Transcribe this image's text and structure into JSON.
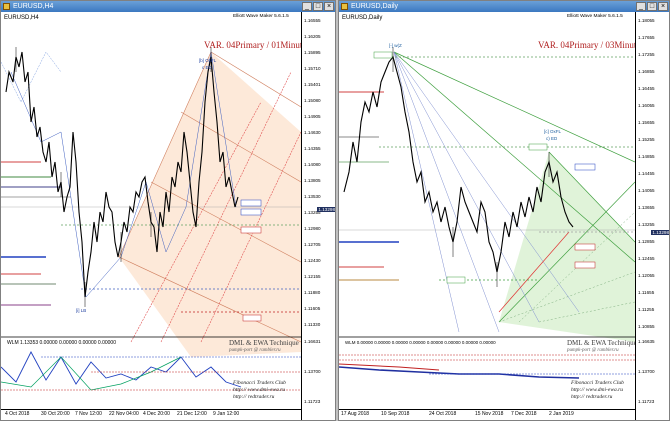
{
  "left": {
    "title": "EURUSD,H4",
    "symbol": "EURUSD,H4",
    "tag": "Elliott Wave Maker 5.6.1.5",
    "var_label": "VAR. 04Primary / 01Minute",
    "price_ticks": [
      "1.16555",
      "1.16205",
      "1.15895",
      "1.15710",
      "1.15401",
      "1.15080",
      "1.14905",
      "1.14630",
      "1.14355",
      "1.14080",
      "1.13805",
      "1.13530",
      "1.13255",
      "1.12980",
      "1.12705",
      "1.12430",
      "1.12155",
      "1.11880",
      "1.11605",
      "1.11330"
    ],
    "current_price": "1.13298",
    "labels": {
      "b_top": "[b] OxFL",
      "b_sub": "c ED",
      "lb": "[i] LB"
    },
    "subwindow_header": "WLM 1.13353 0.00000 0.00000 0.00000 0.00000",
    "sub_ticks": [
      "1.16631",
      "1.13700",
      "1.11723"
    ],
    "technique": "DML & EWA Technique",
    "technique_email": "pumpk-port @ rambler.ru",
    "fibo": [
      "Fibonacci  Traders  Club",
      "http:// www.dmi-ewa.ru",
      "http:// redtrader.ru"
    ],
    "x_ticks": [
      "4 Oct 2018",
      "30 Oct 20:00",
      "7 Nov 12:00",
      "22 Nov 04:00",
      "4 Dec 20:00",
      "21 Dec 12:00",
      "9 Jan 12:00"
    ]
  },
  "right": {
    "title": "EURUSD,Daily",
    "symbol": "EURUSD,Daily",
    "tag": "Elliott Wave Maker 5.6.1.5",
    "var_label": "VAR. 04Primary / 03Minute",
    "price_ticks": [
      "1.18055",
      "1.17655",
      "1.17255",
      "1.16855",
      "1.16455",
      "1.16055",
      "1.15655",
      "1.15255",
      "1.14855",
      "1.14455",
      "1.14055",
      "1.13655",
      "1.13255",
      "1.12855",
      "1.12455",
      "1.12055",
      "1.11655",
      "1.11255",
      "1.10855"
    ],
    "current_price": "1.13298",
    "labels": {
      "top": "[-] w(Z",
      "c": "[c] OxFL",
      "ce": "c) ED"
    },
    "subwindow_header": "WLM 0.00000 0.00000 0.00000 0.00000 0.00000 0.00000 0.00000 0.00000",
    "sub_ticks": [
      "1.16635",
      "1.13700",
      "1.11723"
    ],
    "technique": "DML & EWA Technique",
    "technique_email": "pumpk-port @ rambler.ru",
    "fibo": [
      "Fibonacci  Traders  Club",
      "http:// www.dmi-ewa.ru",
      "http:// redtrader.ru"
    ],
    "x_ticks": [
      "17 Aug 2018",
      "10 Sep 2018",
      "24 Oct 2018",
      "15 Nov 2018",
      "7 Dec 2018",
      "2 Jan 2019"
    ]
  }
}
